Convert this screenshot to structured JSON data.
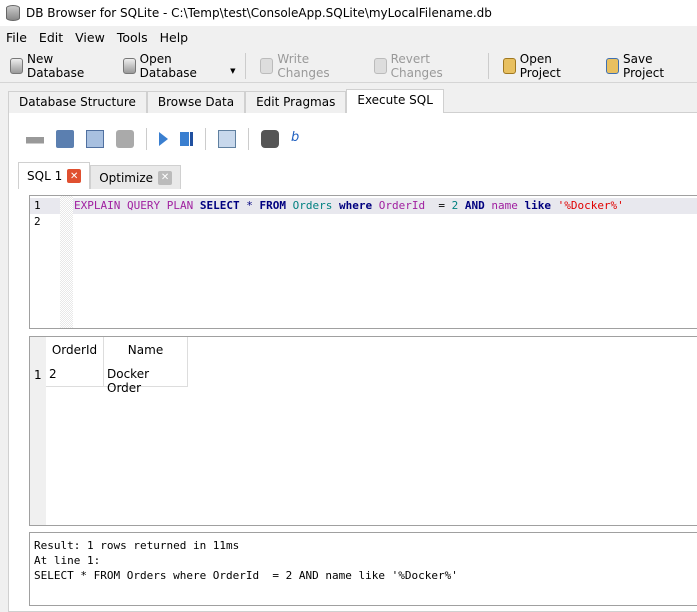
{
  "window": {
    "title": "DB Browser for SQLite - C:\\Temp\\test\\ConsoleApp.SQLite\\myLocalFilename.db"
  },
  "menu": [
    "File",
    "Edit",
    "View",
    "Tools",
    "Help"
  ],
  "toolbar": {
    "new_db": "New Database",
    "open_db": "Open Database",
    "write": "Write Changes",
    "revert": "Revert Changes",
    "open_project": "Open Project",
    "save_project": "Save Project"
  },
  "main_tabs": [
    "Database Structure",
    "Browse Data",
    "Edit Pragmas",
    "Execute SQL"
  ],
  "sql_tabs": [
    "SQL 1",
    "Optimize"
  ],
  "editor": {
    "line_numbers": [
      "1",
      "2"
    ],
    "tokens": [
      {
        "t": "EXPLAIN QUERY PLAN ",
        "c": "#a020a0"
      },
      {
        "t": "SELECT",
        "c": "#00007f",
        "b": true
      },
      {
        "t": " * ",
        "c": "#00007f"
      },
      {
        "t": "FROM",
        "c": "#00007f",
        "b": true
      },
      {
        "t": " ",
        "c": "#000"
      },
      {
        "t": "Orders",
        "c": "#008080"
      },
      {
        "t": " ",
        "c": "#000"
      },
      {
        "t": "where",
        "c": "#00007f",
        "b": true
      },
      {
        "t": " ",
        "c": "#000"
      },
      {
        "t": "OrderId",
        "c": "#a020a0"
      },
      {
        "t": "  = ",
        "c": "#000"
      },
      {
        "t": "2",
        "c": "#008080"
      },
      {
        "t": " ",
        "c": "#000"
      },
      {
        "t": "AND",
        "c": "#00007f",
        "b": true
      },
      {
        "t": " ",
        "c": "#000"
      },
      {
        "t": "name",
        "c": "#a020a0"
      },
      {
        "t": " ",
        "c": "#000"
      },
      {
        "t": "like",
        "c": "#00007f",
        "b": true
      },
      {
        "t": " ",
        "c": "#000"
      },
      {
        "t": "'%Docker%'",
        "c": "#e00000"
      }
    ]
  },
  "grid": {
    "columns": [
      "OrderId",
      "Name"
    ],
    "rows": [
      {
        "num": "1",
        "cells": [
          "2",
          "Docker Order"
        ]
      }
    ]
  },
  "result": {
    "lines": [
      "Result: 1 rows returned in 11ms",
      "At line 1:",
      "SELECT * FROM Orders where OrderId  = 2 AND name like '%Docker%'"
    ]
  }
}
